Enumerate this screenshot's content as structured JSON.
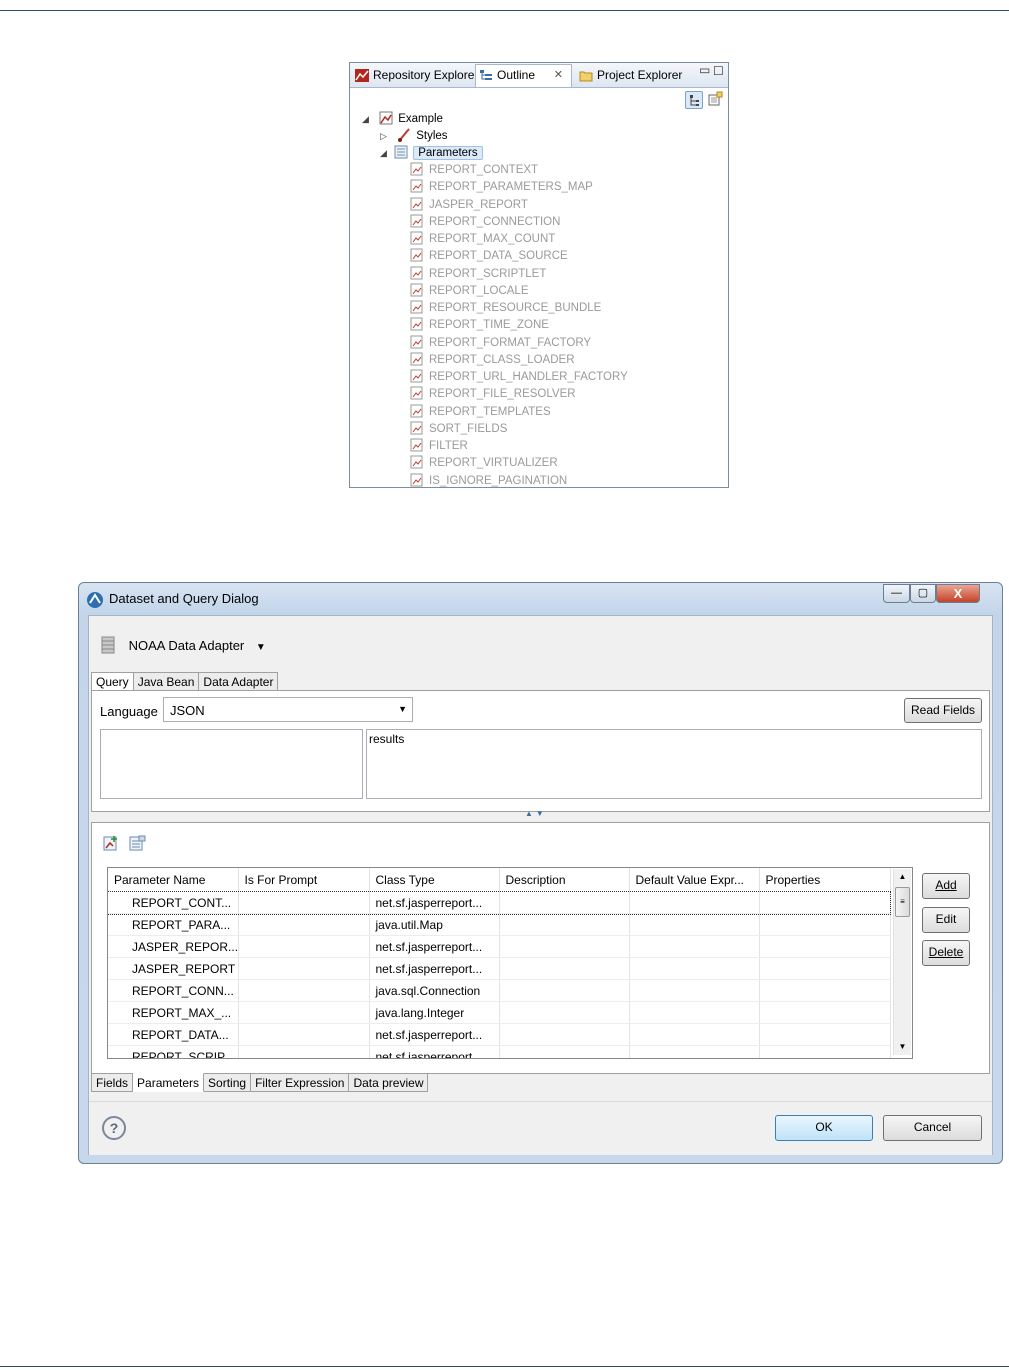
{
  "outline_view": {
    "tabs": [
      {
        "label": "Repository Explorer",
        "icon": "repository-icon",
        "active": false
      },
      {
        "label": "Outline",
        "icon": "outline-icon",
        "active": true,
        "closable": true
      },
      {
        "label": "Project Explorer",
        "icon": "folder-icon",
        "active": false
      }
    ],
    "tree": {
      "root": {
        "label": "Example",
        "expanded": true
      },
      "styles": {
        "label": "Styles",
        "expanded": false
      },
      "parameters": {
        "label": "Parameters",
        "expanded": true,
        "selected": true
      },
      "parameter_items": [
        "REPORT_CONTEXT",
        "REPORT_PARAMETERS_MAP",
        "JASPER_REPORT",
        "REPORT_CONNECTION",
        "REPORT_MAX_COUNT",
        "REPORT_DATA_SOURCE",
        "REPORT_SCRIPTLET",
        "REPORT_LOCALE",
        "REPORT_RESOURCE_BUNDLE",
        "REPORT_TIME_ZONE",
        "REPORT_FORMAT_FACTORY",
        "REPORT_CLASS_LOADER",
        "REPORT_URL_HANDLER_FACTORY",
        "REPORT_FILE_RESOLVER",
        "REPORT_TEMPLATES",
        "SORT_FIELDS",
        "FILTER",
        "REPORT_VIRTUALIZER",
        "IS_IGNORE_PAGINATION"
      ]
    }
  },
  "dialog": {
    "title": "Dataset and Query Dialog",
    "window_buttons": {
      "minimize": "—",
      "maximize": "▢",
      "close": "X"
    },
    "adapter": {
      "label": "NOAA Data Adapter"
    },
    "top_tabs": [
      "Query",
      "Java Bean",
      "Data Adapter"
    ],
    "language_label": "Language",
    "language_value": "JSON",
    "read_fields_label": "Read Fields",
    "query_text": "results",
    "parameters_table": {
      "columns": [
        "Parameter Name",
        "Is For Prompt",
        "Class Type",
        "Description",
        "Default Value Expr...",
        "Properties"
      ],
      "rows": [
        {
          "name": "REPORT_CONT...",
          "prompt": "",
          "class_type": "net.sf.jasperreport...",
          "description": "",
          "default": "",
          "properties": ""
        },
        {
          "name": "REPORT_PARA...",
          "prompt": "",
          "class_type": "java.util.Map",
          "description": "",
          "default": "",
          "properties": ""
        },
        {
          "name": "JASPER_REPOR...",
          "prompt": "",
          "class_type": "net.sf.jasperreport...",
          "description": "",
          "default": "",
          "properties": ""
        },
        {
          "name": "JASPER_REPORT",
          "prompt": "",
          "class_type": "net.sf.jasperreport...",
          "description": "",
          "default": "",
          "properties": ""
        },
        {
          "name": "REPORT_CONN...",
          "prompt": "",
          "class_type": "java.sql.Connection",
          "description": "",
          "default": "",
          "properties": ""
        },
        {
          "name": "REPORT_MAX_...",
          "prompt": "",
          "class_type": "java.lang.Integer",
          "description": "",
          "default": "",
          "properties": ""
        },
        {
          "name": "REPORT_DATA...",
          "prompt": "",
          "class_type": "net.sf.jasperreport...",
          "description": "",
          "default": "",
          "properties": ""
        },
        {
          "name": "REPORT_SCRIP...",
          "prompt": "",
          "class_type": "net.sf.jasperreport...",
          "description": "",
          "default": "",
          "properties": ""
        }
      ]
    },
    "side_buttons": {
      "add": "Add",
      "edit": "Edit",
      "delete": "Delete"
    },
    "bottom_tabs": [
      "Fields",
      "Parameters",
      "Sorting",
      "Filter Expression",
      "Data preview"
    ],
    "active_bottom_tab": "Parameters",
    "help_icon": "help-icon",
    "ok_label": "OK",
    "cancel_label": "Cancel"
  },
  "colors": {
    "accent": "#2b4a6b",
    "selection": "#cde3f7",
    "disabled_text": "#9a9a9a"
  }
}
